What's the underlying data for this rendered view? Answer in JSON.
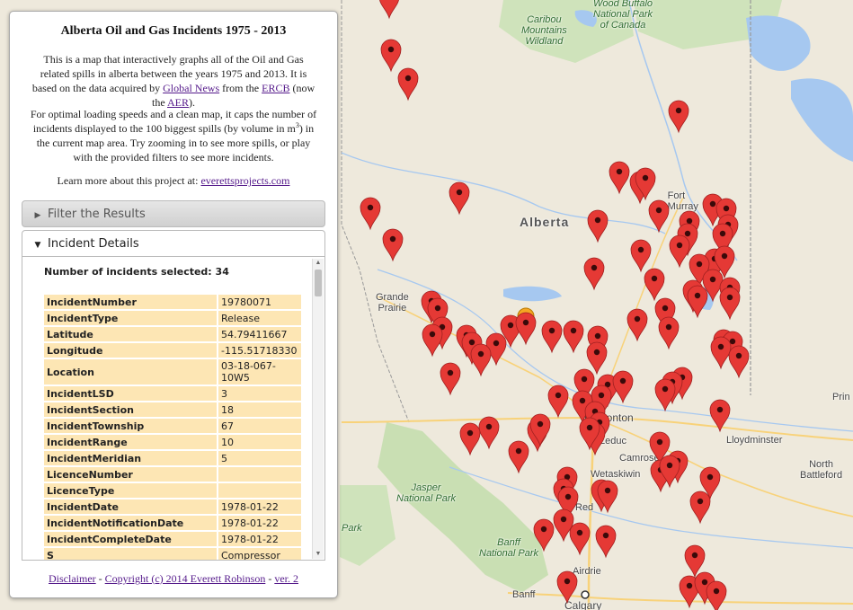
{
  "panel": {
    "title": "Alberta Oil and Gas Incidents 1975 - 2013",
    "intro_a": "This is a map that interactively graphs all of the Oil and Gas related spills in alberta between the years 1975 and 2013. It is based on the data acquired by ",
    "link_global": "Global News",
    "intro_b": " from the ",
    "link_ercb": "ERCB",
    "intro_c": " (now the ",
    "link_aer": "AER",
    "intro_d": ").",
    "speed_a": "For optimal loading speeds and a clean map, it caps the number of incidents displayed to the 100 biggest spills (by volume in m",
    "speed_sup": "3",
    "speed_b": ") in the current map area. Try zooming in to see more spills, or play with the provided filters to see more incidents.",
    "learn_text": "Learn more about this project at: ",
    "learn_link": "everettsprojects.com",
    "filter_label": "Filter the Results",
    "details_label": "Incident Details",
    "count_label": "Number of incidents selected: ",
    "count_value": "34",
    "rows": [
      {
        "key": "IncidentNumber",
        "value": "19780071"
      },
      {
        "key": "IncidentType",
        "value": "Release"
      },
      {
        "key": "Latitude",
        "value": "54.79411667"
      },
      {
        "key": "Longitude",
        "value": "-115.51718330"
      },
      {
        "key": "Location",
        "value": "03-18-067-10W5"
      },
      {
        "key": "IncidentLSD",
        "value": "3"
      },
      {
        "key": "IncidentSection",
        "value": "18"
      },
      {
        "key": "IncidentTownship",
        "value": "67"
      },
      {
        "key": "IncidentRange",
        "value": "10"
      },
      {
        "key": "IncidentMeridian",
        "value": "5"
      },
      {
        "key": "LicenceNumber",
        "value": ""
      },
      {
        "key": "LicenceType",
        "value": ""
      },
      {
        "key": "IncidentDate",
        "value": "1978-01-22"
      },
      {
        "key": "IncidentNotificationDate",
        "value": "1978-01-22"
      },
      {
        "key": "IncidentCompleteDate",
        "value": "1978-01-22"
      },
      {
        "key": "S",
        "value": "Compressor"
      }
    ],
    "footer": {
      "disclaimer": "Disclaimer",
      "sep1": " - ",
      "copyright": "Copyright (c) 2014 Everett Robinson",
      "sep2": " - ",
      "version": "ver. 2"
    }
  },
  "map": {
    "labels": {
      "caribou": "Caribou\nMountains\nWildland",
      "wood_buffalo": "Wood Buffalo\nNational Park\nof Canada",
      "alberta": "Alberta",
      "fort_mcmurray": "Fort\nMcMurray",
      "grande_prairie": "Grande\nPrairie",
      "edmonton": "Edmonton",
      "leduc": "Leduc",
      "camrose": "Camrose",
      "wetaskiwin": "Wetaskiwin",
      "red_deer": "Red",
      "lloydminster": "Lloydminster",
      "north_battleford": "North\nBattleford",
      "prince": "Prin",
      "jasper": "Jasper\nNational Park",
      "park": "Park",
      "banff_np": "Banff\nNational Park",
      "airdrie": "Airdrie",
      "banff": "Banff",
      "calgary": "Calgary"
    },
    "colors": {
      "marker": "#e53935",
      "marker_selected": "#f5a623",
      "water": "#a6c8f0",
      "park": "#c9dfb3",
      "road": "#f8d279"
    },
    "marker_icon": "map-pin-icon"
  }
}
